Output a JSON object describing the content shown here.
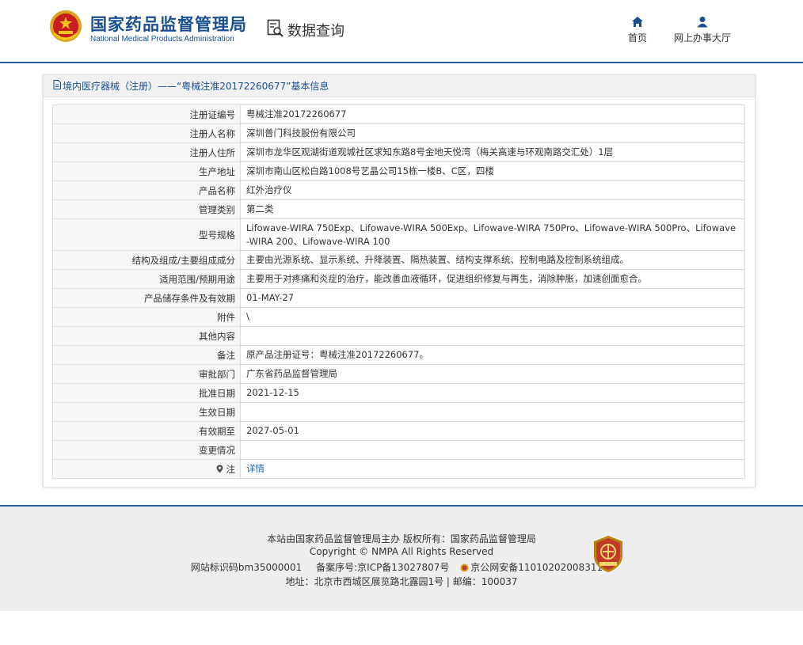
{
  "header": {
    "brand_cn": "国家药品监督管理局",
    "brand_en": "National Medical Products Administration",
    "query_label": "数据查询",
    "nav_home": "首页",
    "nav_hall": "网上办事大厅"
  },
  "panel": {
    "breadcrumb": "境内医疗器械（注册）——“粤械注准20172260677”基本信息"
  },
  "rows": [
    {
      "label": "注册证编号",
      "value": "粤械注准20172260677"
    },
    {
      "label": "注册人名称",
      "value": "深圳普门科技股份有限公司"
    },
    {
      "label": "注册人住所",
      "value": "深圳市龙华区观湖街道观城社区求知东路8号金地天悦湾（梅关高速与环观南路交汇处）1层"
    },
    {
      "label": "生产地址",
      "value": "深圳市南山区松白路1008号艺晶公司15栋一楼B、C区，四楼"
    },
    {
      "label": "产品名称",
      "value": "红外治疗仪"
    },
    {
      "label": "管理类别",
      "value": "第二类"
    },
    {
      "label": "型号规格",
      "value": "Lifowave-WIRA 750Exp、Lifowave-WIRA 500Exp、Lifowave-WIRA 750Pro、Lifowave-WIRA 500Pro、Lifowave-WIRA 200、Lifowave-WIRA 100"
    },
    {
      "label": "结构及组成/主要组成成分",
      "value": "主要由光源系统、显示系统、升降装置、隔热装置、结构支撑系统、控制电路及控制系统组成。"
    },
    {
      "label": "适用范围/预期用途",
      "value": "主要用于对疼痛和炎症的治疗，能改善血液循环，促进组织修复与再生，消除肿胀，加速创面愈合。"
    },
    {
      "label": "产品储存条件及有效期",
      "value": "01-MAY-27"
    },
    {
      "label": "附件",
      "value": "\\"
    },
    {
      "label": "其他内容",
      "value": ""
    },
    {
      "label": "备注",
      "value": "原产品注册证号：粤械注准20172260677。"
    },
    {
      "label": "审批部门",
      "value": "广东省药品监督管理局"
    },
    {
      "label": "批准日期",
      "value": "2021-12-15"
    },
    {
      "label": "生效日期",
      "value": ""
    },
    {
      "label": "有效期至",
      "value": "2027-05-01"
    },
    {
      "label": "变更情况",
      "value": ""
    },
    {
      "label": "注",
      "value": "详情"
    }
  ],
  "footer": {
    "line1": "本站由国家药品监督管理局主办 版权所有：国家药品监督管理局",
    "line2": "Copyright © NMPA All Rights Reserved",
    "site_id": "网站标识码bm35000001",
    "icp": "备案序号:京ICP备13027807号",
    "police": "京公网安备11010202008311号",
    "address": "地址：北京市西城区展览路北露园1号 | 邮编：100037"
  },
  "colors": {
    "brand_blue": "#1a4f8f",
    "rule_blue": "#1b5d9c",
    "link_blue": "#1b66b3",
    "badge_red": "#c0392b"
  },
  "icons": [
    "emblem-logo",
    "data-query-icon",
    "home-icon",
    "user-icon",
    "document-icon",
    "pin-icon",
    "police-icon",
    "gov-badge-icon"
  ]
}
